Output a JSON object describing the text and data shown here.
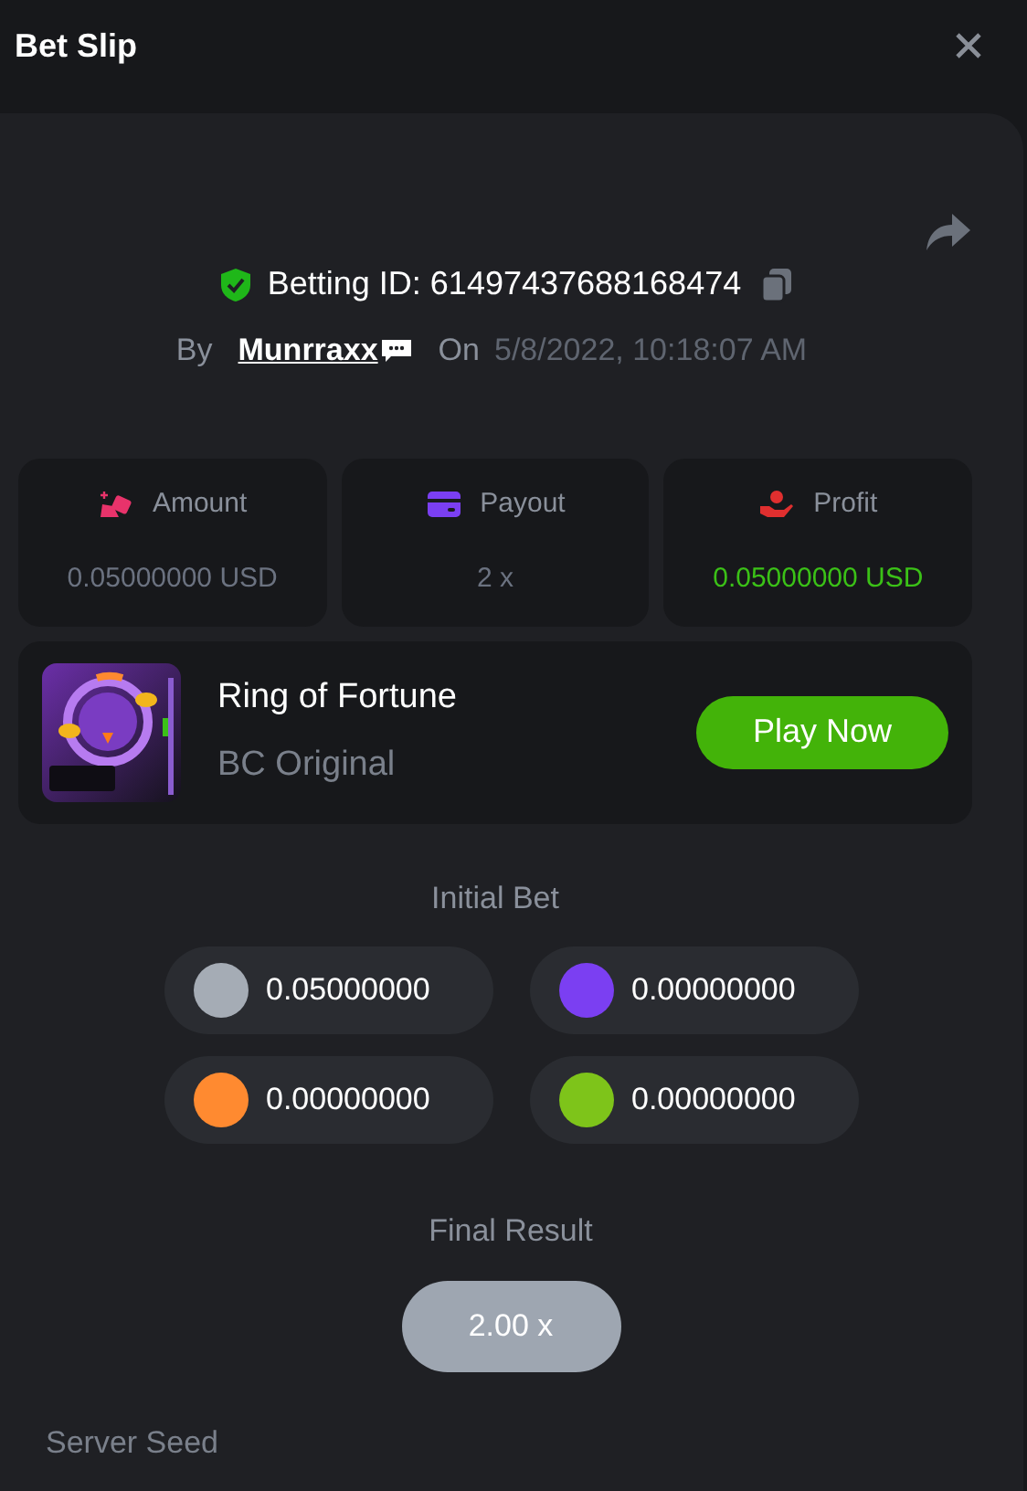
{
  "header": {
    "title": "Bet Slip"
  },
  "bet": {
    "id_label": "Betting ID: 61497437688168474",
    "by_label": "By",
    "user": "Munrraxx",
    "on_label": "On",
    "date": "5/8/2022, 10:18:07 AM"
  },
  "stats": [
    {
      "kind": "amount",
      "label": "Amount",
      "value": "0.05000000 USD",
      "color": "#6b7280"
    },
    {
      "kind": "payout",
      "label": "Payout",
      "value": "2 x",
      "color": "#6b7280"
    },
    {
      "kind": "profit",
      "label": "Profit",
      "value": "0.05000000 USD",
      "color": "#3bc117"
    }
  ],
  "game": {
    "name": "Ring of Fortune",
    "provider": "BC Original",
    "button": "Play Now"
  },
  "initial_bet": {
    "title": "Initial Bet",
    "chips": [
      {
        "color": "#a5acb5",
        "value": "0.05000000"
      },
      {
        "color": "#7b3ff2",
        "value": "0.00000000"
      },
      {
        "color": "#ff8a30",
        "value": "0.00000000"
      },
      {
        "color": "#7ec41a",
        "value": "0.00000000"
      }
    ]
  },
  "final_result": {
    "title": "Final Result",
    "value": "2.00 x"
  },
  "server_seed": {
    "label": "Server Seed"
  }
}
